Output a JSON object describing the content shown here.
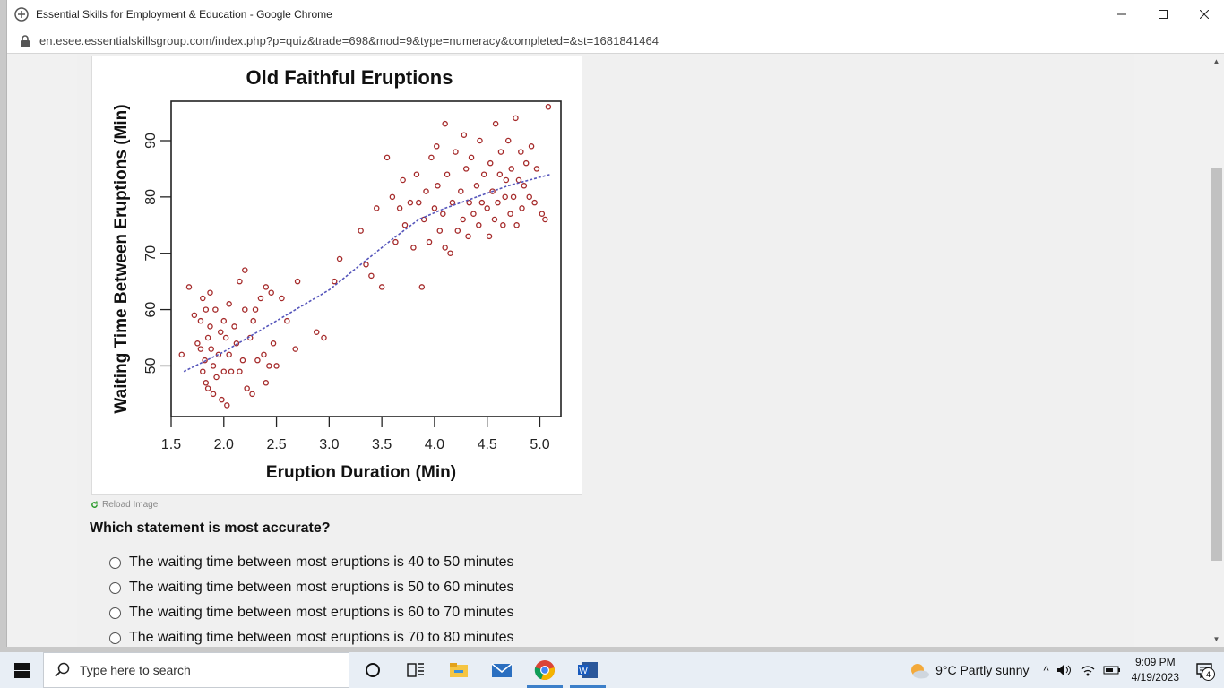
{
  "window": {
    "title": "Essential Skills for Employment & Education - Google Chrome",
    "url": "en.esee.essentialskillsgroup.com/index.php?p=quiz&trade=698&mod=9&type=numeracy&completed=&st=1681841464"
  },
  "chart_data": {
    "type": "scatter",
    "title": "Old Faithful Eruptions",
    "xlabel": "Eruption Duration (Min)",
    "ylabel": "Waiting Time Between Eruptions (Min)",
    "xlim": [
      1.5,
      5.2
    ],
    "ylim": [
      41,
      97
    ],
    "x_ticks": [
      "1.5",
      "2.0",
      "2.5",
      "3.0",
      "3.5",
      "4.0",
      "4.5",
      "5.0"
    ],
    "y_ticks": [
      "50",
      "60",
      "70",
      "80",
      "90"
    ],
    "point_color": "#a52a2a",
    "trend_color": "#5555bb",
    "grid": false,
    "series": [
      {
        "points": [
          [
            1.6,
            52
          ],
          [
            1.67,
            64
          ],
          [
            1.72,
            59
          ],
          [
            1.75,
            54
          ],
          [
            1.78,
            53
          ],
          [
            1.78,
            58
          ],
          [
            1.8,
            62
          ],
          [
            1.8,
            49
          ],
          [
            1.82,
            51
          ],
          [
            1.83,
            60
          ],
          [
            1.83,
            47
          ],
          [
            1.85,
            55
          ],
          [
            1.85,
            46
          ],
          [
            1.87,
            63
          ],
          [
            1.87,
            57
          ],
          [
            1.88,
            53
          ],
          [
            1.9,
            50
          ],
          [
            1.9,
            45
          ],
          [
            1.92,
            60
          ],
          [
            1.93,
            48
          ],
          [
            1.95,
            52
          ],
          [
            1.97,
            56
          ],
          [
            1.98,
            44
          ],
          [
            2.0,
            58
          ],
          [
            2.0,
            49
          ],
          [
            2.02,
            55
          ],
          [
            2.03,
            43
          ],
          [
            2.05,
            61
          ],
          [
            2.05,
            52
          ],
          [
            2.07,
            49
          ],
          [
            2.1,
            57
          ],
          [
            2.12,
            54
          ],
          [
            2.15,
            65
          ],
          [
            2.15,
            49
          ],
          [
            2.18,
            51
          ],
          [
            2.2,
            60
          ],
          [
            2.2,
            67
          ],
          [
            2.22,
            46
          ],
          [
            2.25,
            55
          ],
          [
            2.27,
            45
          ],
          [
            2.28,
            58
          ],
          [
            2.3,
            60
          ],
          [
            2.32,
            51
          ],
          [
            2.35,
            62
          ],
          [
            2.38,
            52
          ],
          [
            2.4,
            47
          ],
          [
            2.4,
            64
          ],
          [
            2.43,
            50
          ],
          [
            2.45,
            63
          ],
          [
            2.47,
            54
          ],
          [
            2.5,
            50
          ],
          [
            2.55,
            62
          ],
          [
            2.6,
            58
          ],
          [
            2.68,
            53
          ],
          [
            2.7,
            65
          ],
          [
            2.88,
            56
          ],
          [
            2.95,
            55
          ],
          [
            3.05,
            65
          ],
          [
            3.1,
            69
          ],
          [
            3.3,
            74
          ],
          [
            3.35,
            68
          ],
          [
            3.4,
            66
          ],
          [
            3.45,
            78
          ],
          [
            3.5,
            64
          ],
          [
            3.55,
            87
          ],
          [
            3.6,
            80
          ],
          [
            3.63,
            72
          ],
          [
            3.67,
            78
          ],
          [
            3.7,
            83
          ],
          [
            3.72,
            75
          ],
          [
            3.77,
            79
          ],
          [
            3.8,
            71
          ],
          [
            3.83,
            84
          ],
          [
            3.85,
            79
          ],
          [
            3.88,
            64
          ],
          [
            3.9,
            76
          ],
          [
            3.92,
            81
          ],
          [
            3.95,
            72
          ],
          [
            3.97,
            87
          ],
          [
            4.0,
            78
          ],
          [
            4.02,
            89
          ],
          [
            4.03,
            82
          ],
          [
            4.05,
            74
          ],
          [
            4.08,
            77
          ],
          [
            4.1,
            71
          ],
          [
            4.1,
            93
          ],
          [
            4.12,
            84
          ],
          [
            4.15,
            70
          ],
          [
            4.17,
            79
          ],
          [
            4.2,
            88
          ],
          [
            4.22,
            74
          ],
          [
            4.25,
            81
          ],
          [
            4.27,
            76
          ],
          [
            4.28,
            91
          ],
          [
            4.3,
            85
          ],
          [
            4.32,
            73
          ],
          [
            4.33,
            79
          ],
          [
            4.35,
            87
          ],
          [
            4.37,
            77
          ],
          [
            4.4,
            82
          ],
          [
            4.42,
            75
          ],
          [
            4.43,
            90
          ],
          [
            4.45,
            79
          ],
          [
            4.47,
            84
          ],
          [
            4.5,
            78
          ],
          [
            4.52,
            73
          ],
          [
            4.53,
            86
          ],
          [
            4.55,
            81
          ],
          [
            4.57,
            76
          ],
          [
            4.58,
            93
          ],
          [
            4.6,
            79
          ],
          [
            4.62,
            84
          ],
          [
            4.63,
            88
          ],
          [
            4.65,
            75
          ],
          [
            4.67,
            80
          ],
          [
            4.68,
            83
          ],
          [
            4.7,
            90
          ],
          [
            4.72,
            77
          ],
          [
            4.73,
            85
          ],
          [
            4.75,
            80
          ],
          [
            4.77,
            94
          ],
          [
            4.78,
            75
          ],
          [
            4.8,
            83
          ],
          [
            4.82,
            88
          ],
          [
            4.83,
            78
          ],
          [
            4.85,
            82
          ],
          [
            4.87,
            86
          ],
          [
            4.9,
            80
          ],
          [
            4.92,
            89
          ],
          [
            4.95,
            79
          ],
          [
            4.97,
            85
          ],
          [
            5.02,
            77
          ],
          [
            5.05,
            76
          ],
          [
            5.08,
            96
          ]
        ]
      }
    ],
    "trend_line": [
      [
        1.62,
        49
      ],
      [
        2.0,
        52.5
      ],
      [
        2.5,
        58
      ],
      [
        3.0,
        63.5
      ],
      [
        3.3,
        68
      ],
      [
        3.6,
        72.5
      ],
      [
        3.85,
        76
      ],
      [
        4.1,
        78
      ],
      [
        4.4,
        80
      ],
      [
        4.7,
        82
      ],
      [
        5.1,
        84
      ]
    ]
  },
  "quiz": {
    "reload_label": "Reload Image",
    "question": "Which statement is most accurate?",
    "options": [
      "The waiting time between most eruptions is 40 to 50 minutes",
      "The waiting time between most eruptions is 50 to 60 minutes",
      "The waiting time between most eruptions is 60 to 70 minutes",
      "The waiting time between most eruptions is 70 to 80 minutes"
    ]
  },
  "taskbar": {
    "search_placeholder": "Type here to search",
    "weather": "9°C  Partly sunny",
    "time": "9:09 PM",
    "date": "4/19/2023",
    "notification_count": "4"
  }
}
